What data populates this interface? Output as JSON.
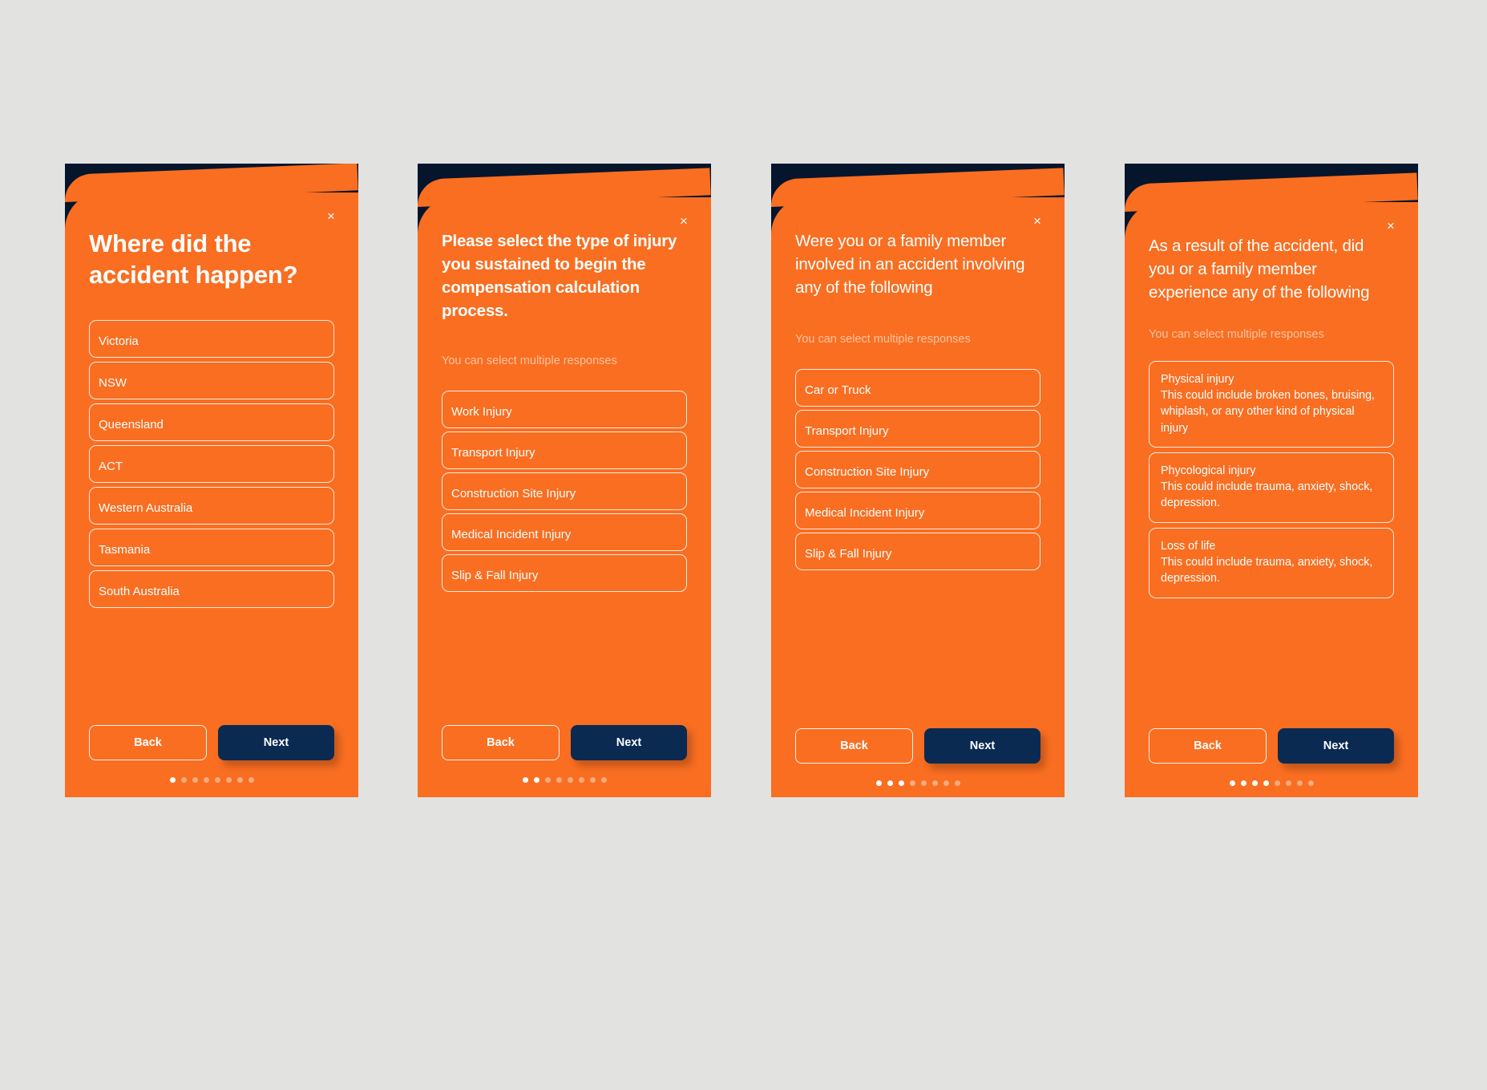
{
  "theme": {
    "page_background": "#e2e2e1",
    "sheet_orange": "#f96e21",
    "phone_navy": "#05152b",
    "button_navy": "#0a2a52",
    "behind_card_teal": "#14607f",
    "subtitle_color": "#ffc3a1"
  },
  "common": {
    "close_label": "×",
    "back_label": "Back",
    "next_label": "Next",
    "multi_select_note": "You can select multiple responses",
    "total_dots": 8
  },
  "screens": [
    {
      "id": "screen-location",
      "heading": "Where did the accident happen?",
      "heading_style": "big",
      "subtitle": "",
      "active_dots": 1,
      "options": [
        {
          "title": "Victoria"
        },
        {
          "title": "NSW"
        },
        {
          "title": "Queensland"
        },
        {
          "title": "ACT"
        },
        {
          "title": "Western Australia"
        },
        {
          "title": "Tasmania"
        },
        {
          "title": "South Australia"
        }
      ]
    },
    {
      "id": "screen-injury-type",
      "heading": "Please select the type of injury you sustained to begin the compensation calculation process.",
      "heading_style": "mid",
      "subtitle": "You can select multiple responses",
      "active_dots": 2,
      "options": [
        {
          "title": "Work Injury"
        },
        {
          "title": "Transport Injury"
        },
        {
          "title": "Construction Site Injury"
        },
        {
          "title": "Medical Incident Injury"
        },
        {
          "title": "Slip & Fall Injury"
        }
      ]
    },
    {
      "id": "screen-accident-involvement",
      "heading": "Were you or a family member involved in an accident involving any of the following",
      "heading_style": "light",
      "subtitle": "You can select multiple responses",
      "active_dots": 3,
      "options": [
        {
          "title": "Car or Truck"
        },
        {
          "title": "Transport Injury"
        },
        {
          "title": "Construction Site Injury"
        },
        {
          "title": "Medical Incident Injury"
        },
        {
          "title": "Slip & Fall Injury"
        }
      ]
    },
    {
      "id": "screen-experience",
      "heading": "As a result of the accident, did you or a family member experience any of the following",
      "heading_style": "light",
      "subtitle": "You can select multiple responses",
      "active_dots": 4,
      "options": [
        {
          "title": "Physical injury",
          "description": "This could include broken bones, bruising, whiplash, or any other kind of physical injury"
        },
        {
          "title": "Phycological injury",
          "description": "This could include trauma, anxiety, shock, depression."
        },
        {
          "title": "Loss of life",
          "description": "This could include trauma, anxiety, shock, depression."
        }
      ]
    }
  ]
}
